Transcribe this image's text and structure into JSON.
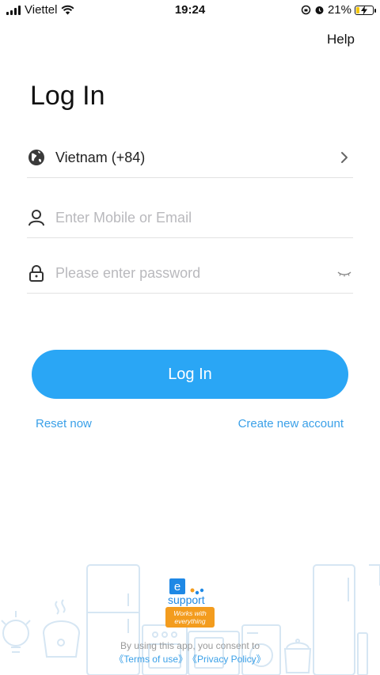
{
  "status_bar": {
    "carrier": "Viettel",
    "time": "19:24",
    "battery_percent": "21%",
    "battery_level": 0.21,
    "icons": [
      "signal-icon",
      "wifi-icon",
      "rotation-lock-icon",
      "alarm-icon",
      "battery-charging-icon"
    ]
  },
  "header": {
    "help_label": "Help"
  },
  "main": {
    "title": "Log In",
    "country": {
      "value": "Vietnam (+84)",
      "icon": "globe-icon",
      "chevron_icon": "chevron-right-icon"
    },
    "account_field": {
      "placeholder": "Enter Mobile or Email",
      "value": "",
      "icon": "user-icon"
    },
    "password_field": {
      "placeholder": "Please enter password",
      "value": "",
      "icon": "lock-icon",
      "toggle_icon": "eye-closed-icon"
    },
    "login_button_label": "Log In",
    "reset_label": "Reset now",
    "create_account_label": "Create new account"
  },
  "footer": {
    "brand_e": "e",
    "brand_name": "support",
    "brand_tagline": "Works with everything",
    "consent_text": "By using this app, you consent to",
    "terms_label": "《Terms of use》",
    "privacy_label": "《Privacy Policy》"
  },
  "colors": {
    "accent": "#2aa6f5",
    "link": "#3aa0e8",
    "placeholder": "#b9b9bd",
    "divider": "#e2e2e2",
    "brand_orange": "#f39c1e",
    "brand_blue": "#1e88e5",
    "illustration": "#d6e6f3"
  }
}
